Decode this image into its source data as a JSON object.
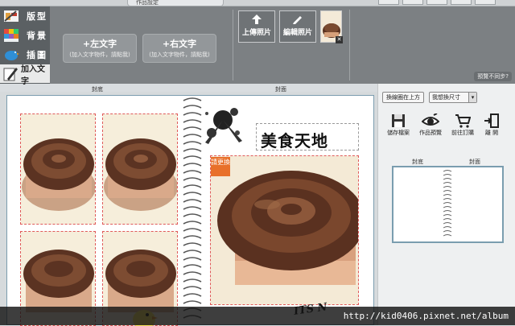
{
  "top_bar": {
    "tab_label": "作品設定"
  },
  "sidebar": {
    "items": [
      {
        "label": "版型",
        "icon": "layout-icon"
      },
      {
        "label": "背景",
        "icon": "palette-icon"
      },
      {
        "label": "插圖",
        "icon": "bird-icon"
      },
      {
        "label": "加入文字",
        "icon": "pencil-page-icon",
        "active": true
      }
    ]
  },
  "toolbar": {
    "left_text": {
      "label": "+左文字",
      "hint": "(加入文字物件，請點我)"
    },
    "right_text": {
      "label": "+右文字",
      "hint": "(加入文字物件，請點我)"
    },
    "upload_photo": "上傳照片",
    "edit_photo": "編輯照片",
    "preview_note": "預覽不同步?"
  },
  "pages": {
    "back_label": "封底",
    "front_label": "封面"
  },
  "canvas": {
    "title_text": "美食天地",
    "change_badge": "請更換",
    "stamp_text": "ITS N"
  },
  "right_panel": {
    "switch_top_button": "換線圈在上方",
    "size_select": "我想換尺寸",
    "actions": [
      {
        "label": "儲存檔案",
        "icon": "save-icon"
      },
      {
        "label": "作品預覽",
        "icon": "eye-icon"
      },
      {
        "label": "前往訂購",
        "icon": "cart-icon"
      },
      {
        "label": "離 開",
        "icon": "exit-icon"
      }
    ],
    "mini_back_label": "封底",
    "mini_front_label": "封面"
  },
  "watermark": "http://kid0406.pixnet.net/album",
  "colors": {
    "sidebar_bg": "#5b6063",
    "toolbar_bg": "#7c8083",
    "slot_border": "#e05a5a",
    "badge": "#e8702a",
    "book_border": "#7b9cae"
  }
}
